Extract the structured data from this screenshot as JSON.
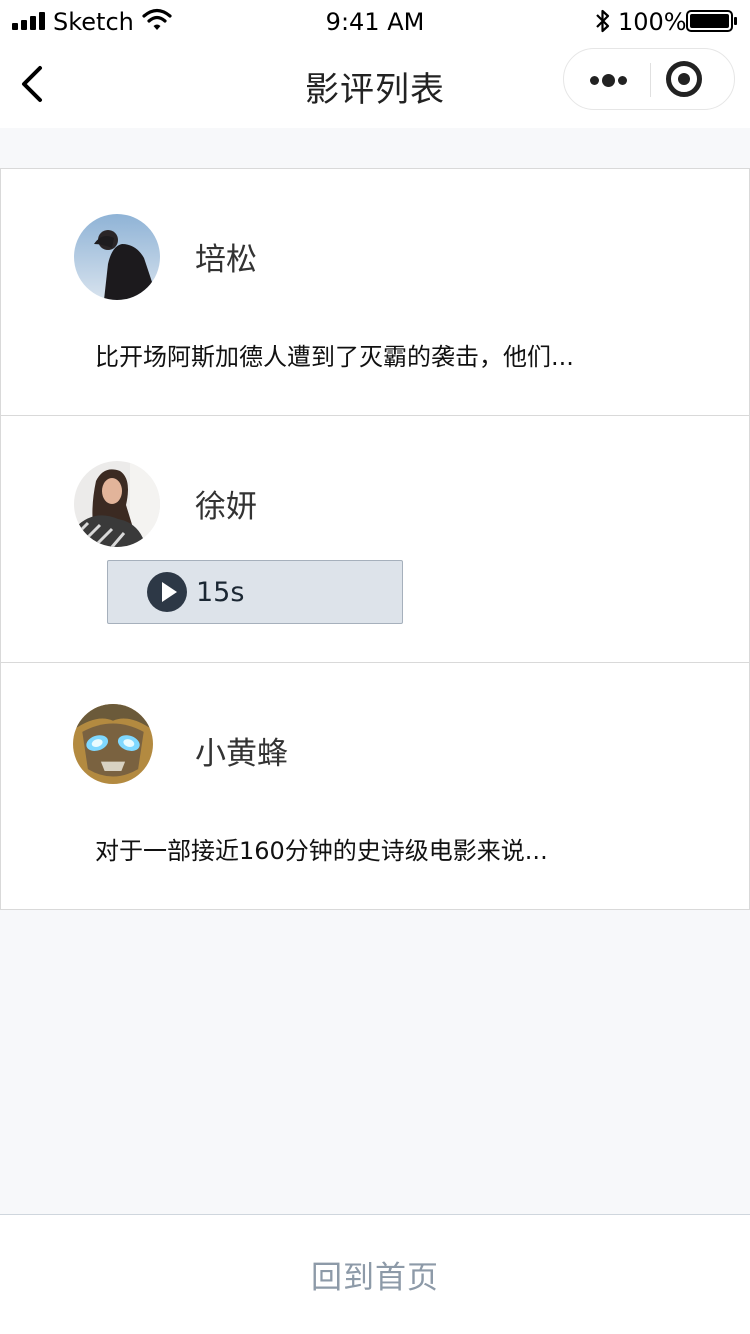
{
  "status_bar": {
    "carrier": "Sketch",
    "time": "9:41 AM",
    "battery": "100%",
    "icons": [
      "signal-icon",
      "wifi-icon",
      "bluetooth-icon",
      "battery-icon"
    ]
  },
  "nav": {
    "title": "影评列表",
    "back_icon": "chevron-left-icon",
    "more_icon": "more-dots-icon",
    "close_icon": "target-circle-icon"
  },
  "reviews": [
    {
      "author": "培松",
      "type": "text",
      "content": "比开场阿斯加德人遭到了灭霸的袭击，他们..."
    },
    {
      "author": "徐妍",
      "type": "audio",
      "duration": "15s",
      "audio_icon": "play-icon"
    },
    {
      "author": "小黄蜂",
      "type": "text",
      "content": "对于一部接近160分钟的史诗级电影来说..."
    }
  ],
  "footer": {
    "home_label": "回到首页"
  },
  "colors": {
    "page_background": "#f7f8fa",
    "card_background": "#ffffff",
    "audio_background": "#dde3ea",
    "home_text": "#8d9aa8"
  }
}
